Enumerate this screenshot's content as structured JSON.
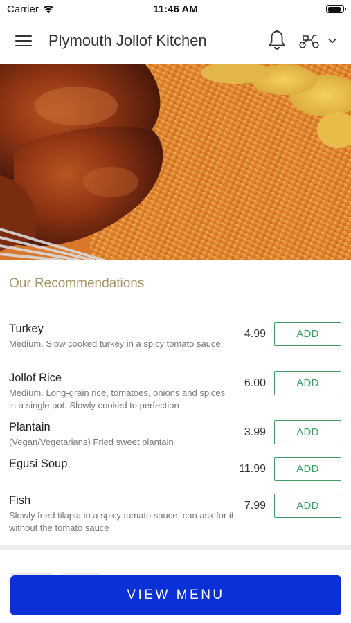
{
  "status_bar": {
    "carrier": "Carrier",
    "time": "11:46 AM",
    "battery_level": 0.95
  },
  "header": {
    "title": "Plymouth Jollof Kitchen",
    "icons": [
      "menu-icon",
      "bell-icon",
      "scooter-icon",
      "chevron-down-icon"
    ]
  },
  "hero": {
    "description_icon": "food-photo"
  },
  "recommendations": {
    "title": "Our Recommendations",
    "items": [
      {
        "name": "Turkey",
        "description": "Medium. Slow cooked turkey in a spicy tomato sauce",
        "price": "4.99",
        "add_label": "ADD"
      },
      {
        "name": "Jollof Rice",
        "description": "Medium. Long-grain rice, tomatoes, onions and spices in a single pot. Slowly cooked to perfection",
        "price": "6.00",
        "add_label": "ADD"
      },
      {
        "name": "Plantain",
        "description": "(Vegan/Vegetarians) Fried sweet plantain",
        "price": "3.99",
        "add_label": "ADD"
      },
      {
        "name": "Egusi Soup",
        "description": "",
        "price": "11.99",
        "add_label": "ADD"
      },
      {
        "name": "Fish",
        "description": "Slowly fried tilapia in a spicy tomato sauce. can ask for it without the tomato sauce",
        "price": "7.99",
        "add_label": "ADD"
      }
    ]
  },
  "footer": {
    "view_menu_label": "VIEW MENU"
  },
  "colors": {
    "accent_gold": "#a8956a",
    "add_green": "#3f9e63",
    "button_blue": "#0b31d6"
  }
}
